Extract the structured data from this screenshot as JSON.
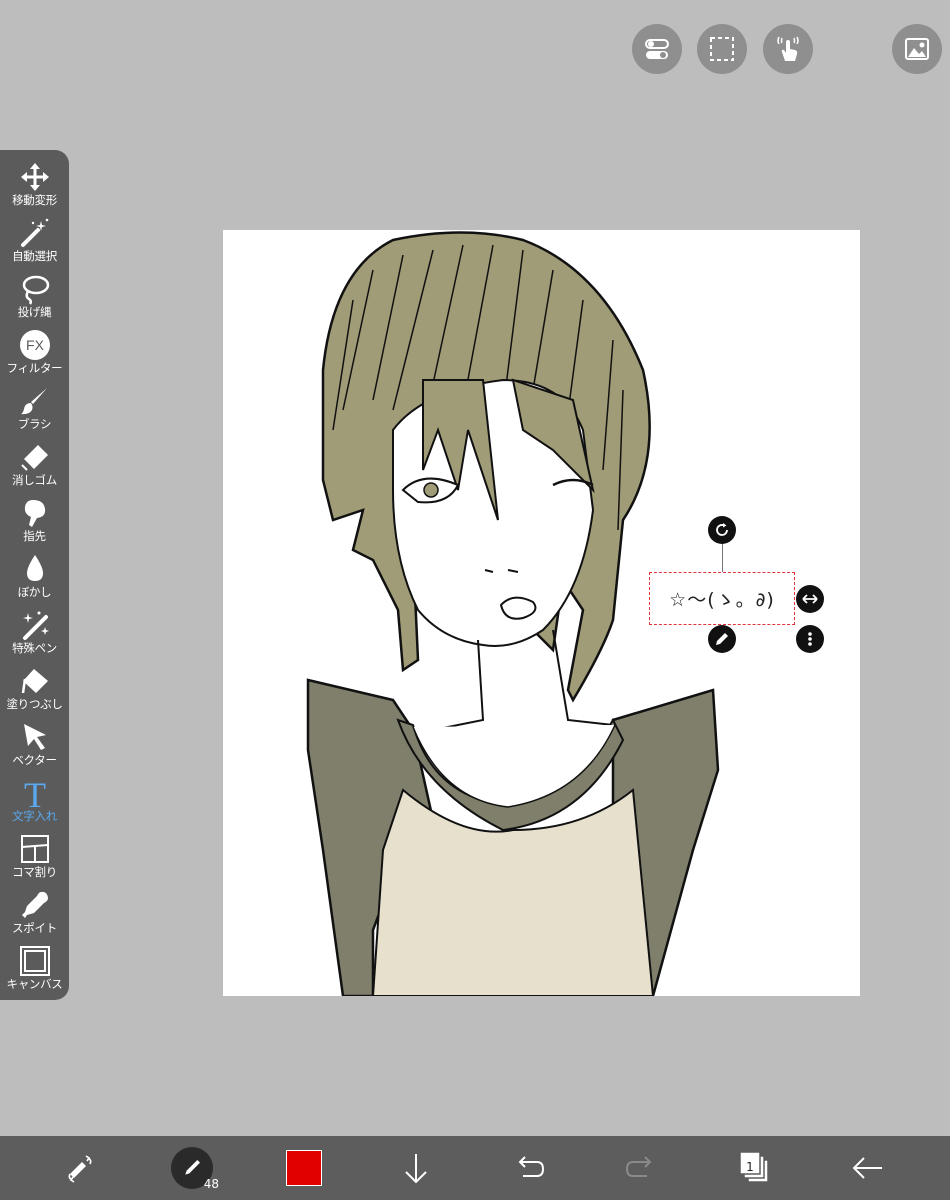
{
  "tools": [
    {
      "label": "移動変形",
      "icon": "move-icon"
    },
    {
      "label": "自動選択",
      "icon": "magic-wand-icon"
    },
    {
      "label": "投げ縄",
      "icon": "lasso-icon"
    },
    {
      "label": "フィルター",
      "icon": "fx-icon",
      "glyph": "FX"
    },
    {
      "label": "ブラシ",
      "icon": "brush-icon"
    },
    {
      "label": "消しゴム",
      "icon": "eraser-icon"
    },
    {
      "label": "指先",
      "icon": "finger-icon"
    },
    {
      "label": "ぼかし",
      "icon": "blur-drop-icon"
    },
    {
      "label": "特殊ペン",
      "icon": "special-pen-icon"
    },
    {
      "label": "塗りつぶし",
      "icon": "fill-bucket-icon"
    },
    {
      "label": "ベクター",
      "icon": "vector-arrow-icon"
    },
    {
      "label": "文字入れ",
      "icon": "text-icon",
      "glyph": "T",
      "active": true
    },
    {
      "label": "コマ割り",
      "icon": "panel-split-icon"
    },
    {
      "label": "スポイト",
      "icon": "eyedropper-icon"
    },
    {
      "label": "キャンバス",
      "icon": "canvas-icon"
    }
  ],
  "top_buttons": [
    "toggle-icon",
    "selection-icon",
    "gesture-icon",
    "gallery-icon"
  ],
  "canvas_text": "☆～(ゝ。∂)",
  "bottom": {
    "brush_size": "48",
    "color": "#e00000",
    "layer_count": "1"
  },
  "colors": {
    "toolbar": "#5b5b5b",
    "active_tool": "#5aa9ef",
    "background": "#bdbdbd",
    "hair": "#a09c78",
    "shirt_sleeve": "#7f7f6c",
    "shirt_body": "#e6e0cd"
  }
}
